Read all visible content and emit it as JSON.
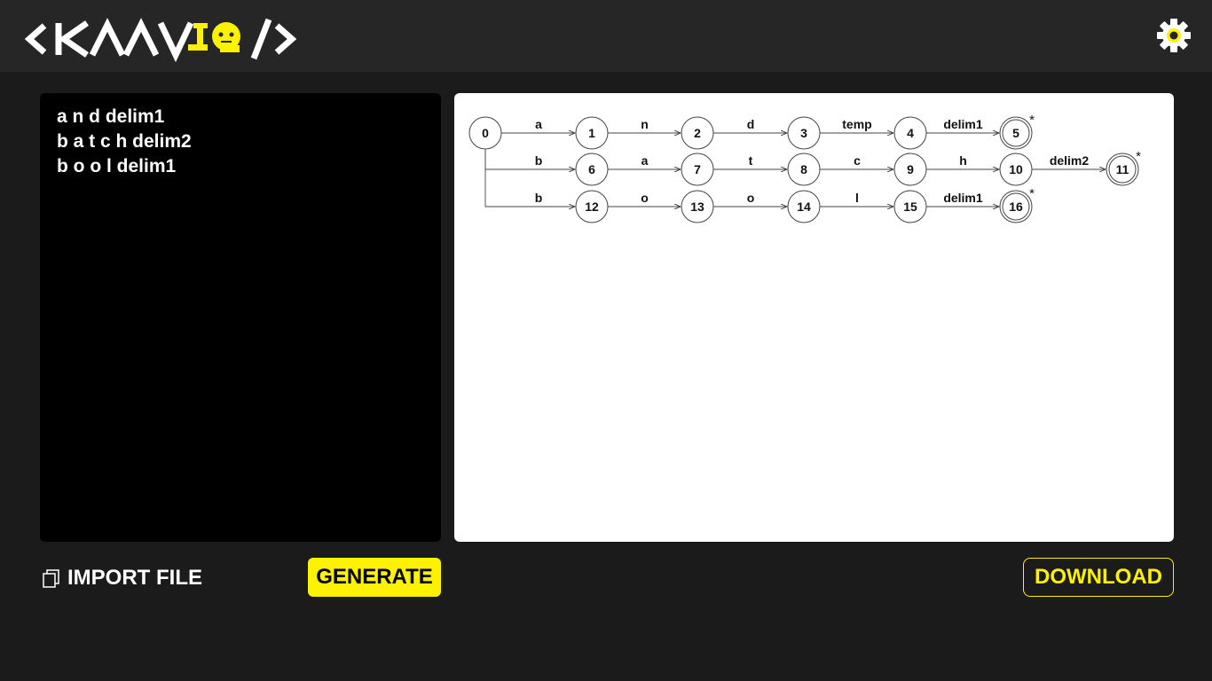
{
  "header": {
    "logo_text": "<KAAVIO/>",
    "settings_icon": "gear-icon"
  },
  "colors": {
    "accent": "#fff200",
    "header_bg": "#262626",
    "page_bg": "#1b1b1b",
    "editor_bg": "#000000"
  },
  "editor": {
    "lines": [
      "a n d delim1",
      "b a t c h delim2",
      "b o o l delim1"
    ]
  },
  "diagram": {
    "states": [
      {
        "id": "0",
        "final": false
      },
      {
        "id": "1",
        "final": false
      },
      {
        "id": "2",
        "final": false
      },
      {
        "id": "3",
        "final": false
      },
      {
        "id": "4",
        "final": false
      },
      {
        "id": "5",
        "final": true,
        "star": "*"
      },
      {
        "id": "6",
        "final": false
      },
      {
        "id": "7",
        "final": false
      },
      {
        "id": "8",
        "final": false
      },
      {
        "id": "9",
        "final": false
      },
      {
        "id": "10",
        "final": false
      },
      {
        "id": "11",
        "final": true,
        "star": "*"
      },
      {
        "id": "12",
        "final": false
      },
      {
        "id": "13",
        "final": false
      },
      {
        "id": "14",
        "final": false
      },
      {
        "id": "15",
        "final": false
      },
      {
        "id": "16",
        "final": true,
        "star": "*"
      }
    ],
    "transitions": [
      {
        "from": "0",
        "to": "1",
        "label": "a"
      },
      {
        "from": "1",
        "to": "2",
        "label": "n"
      },
      {
        "from": "2",
        "to": "3",
        "label": "d"
      },
      {
        "from": "3",
        "to": "4",
        "label": "temp"
      },
      {
        "from": "4",
        "to": "5",
        "label": "delim1"
      },
      {
        "from": "0",
        "to": "6",
        "label": "b"
      },
      {
        "from": "6",
        "to": "7",
        "label": "a"
      },
      {
        "from": "7",
        "to": "8",
        "label": "t"
      },
      {
        "from": "8",
        "to": "9",
        "label": "c"
      },
      {
        "from": "9",
        "to": "10",
        "label": "h"
      },
      {
        "from": "10",
        "to": "11",
        "label": "delim2"
      },
      {
        "from": "0",
        "to": "12",
        "label": "b"
      },
      {
        "from": "12",
        "to": "13",
        "label": "o"
      },
      {
        "from": "13",
        "to": "14",
        "label": "o"
      },
      {
        "from": "14",
        "to": "15",
        "label": "l"
      },
      {
        "from": "15",
        "to": "16",
        "label": "delim1"
      }
    ]
  },
  "actions": {
    "import_label": "IMPORT FILE",
    "import_icon": "copy-icon",
    "generate_label": "GENERATE",
    "download_label": "DOWNLOAD"
  }
}
